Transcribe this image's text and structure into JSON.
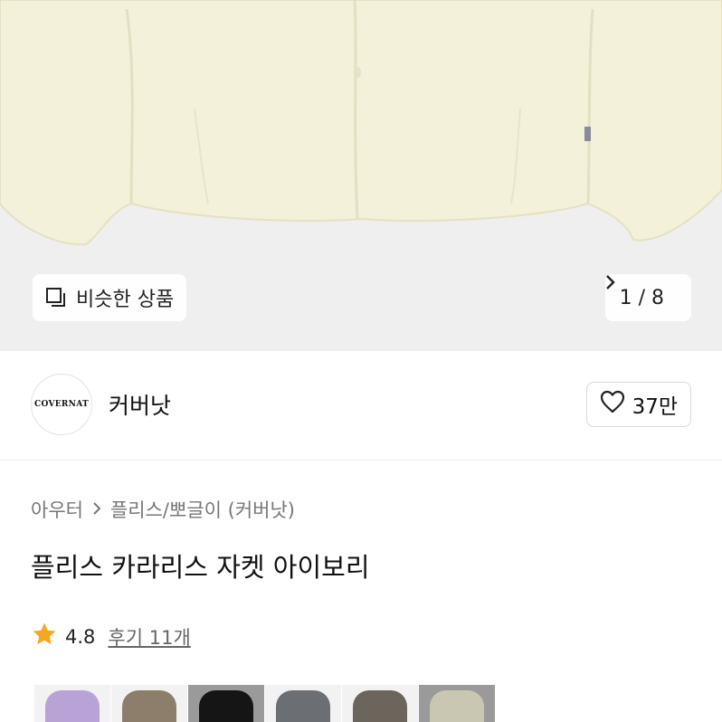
{
  "hero": {
    "similar_label": "비슷한 상품",
    "pager_text": "1 / 8",
    "jacket_color": "#f3f1da"
  },
  "brand": {
    "logo_text": "COVERNAT",
    "name": "커버낫",
    "likes": "37만"
  },
  "breadcrumb": {
    "level1": "아우터",
    "level2": "플리스/뽀글이 (커버낫)"
  },
  "product": {
    "title": "플리스 카라리스 자켓 아이보리"
  },
  "rating": {
    "score": "4.8",
    "reviews": "후기 11개"
  },
  "colors": {
    "swatches": [
      {
        "bg": "#f2f2f2",
        "fill": "#b9a3d6"
      },
      {
        "bg": "#f2f2f2",
        "fill": "#8c7e6a"
      },
      {
        "bg": "#9a9a9a",
        "fill": "#151515"
      },
      {
        "bg": "#f2f2f2",
        "fill": "#6b6e73"
      },
      {
        "bg": "#f2f2f2",
        "fill": "#6b655c"
      },
      {
        "bg": "#9a9a9a",
        "fill": "#c9c7b2"
      }
    ]
  }
}
